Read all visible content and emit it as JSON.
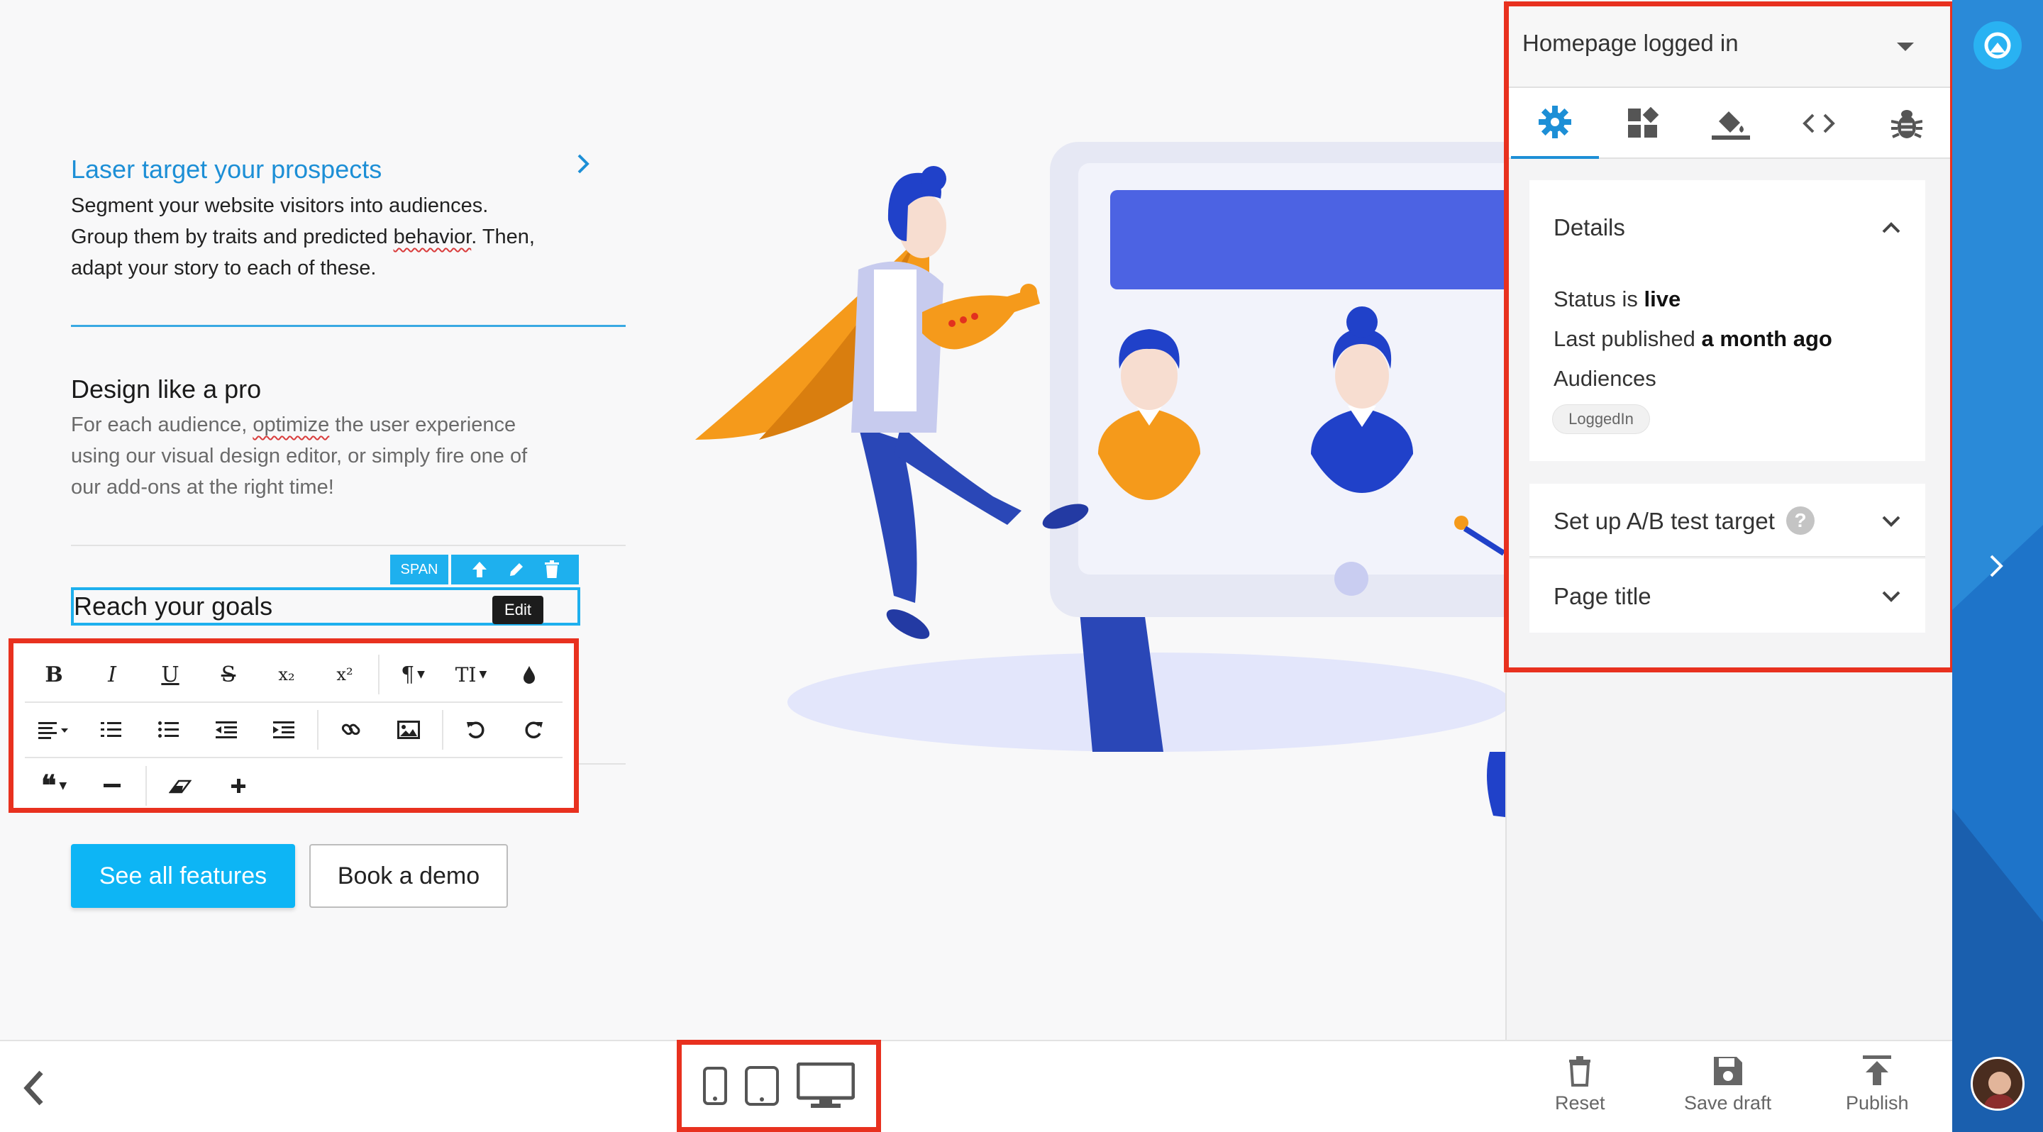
{
  "features": [
    {
      "title": "Laser target your prospects",
      "lines": [
        "Segment your website visitors into audiences.",
        "Group them by traits and predicted ",
        "behavior",
        ". Then,",
        "adapt your story to each of these."
      ]
    },
    {
      "title": "Design like a pro",
      "lines": [
        "For each audience, ",
        "optimize",
        " the user experience",
        "using our visual design editor, or simply fire one of",
        "our add-ons at the right time!"
      ]
    },
    {
      "title": "Reach your goals"
    }
  ],
  "element_tag": "SPAN",
  "tooltip": "Edit",
  "buttons": {
    "primary": "See all features",
    "secondary": "Book a demo"
  },
  "toolbar": {
    "bold": "B",
    "italic": "I",
    "underline": "U",
    "strike": "S",
    "subscript": "x₂",
    "superscript": "x²",
    "paragraph": "¶",
    "textsize": "TI"
  },
  "panel": {
    "page_select": "Homepage logged in",
    "tabs": [
      "settings",
      "widgets",
      "style",
      "code",
      "debug"
    ],
    "details": {
      "title": "Details",
      "status_prefix": "Status is ",
      "status_value": "live",
      "published_prefix": "Last published ",
      "published_value": "a month ago",
      "audiences_label": "Audiences",
      "audience_tag": "LoggedIn"
    },
    "ab_test": "Set up A/B test target",
    "page_title": "Page title"
  },
  "actions": {
    "reset": "Reset",
    "save": "Save draft",
    "publish": "Publish"
  },
  "colors": {
    "accent": "#0db5f5",
    "highlight": "#e8311f",
    "brand_blue": "#1e74c9",
    "illustration_blue": "#4c63e3",
    "illustration_orange": "#f59a1b"
  }
}
